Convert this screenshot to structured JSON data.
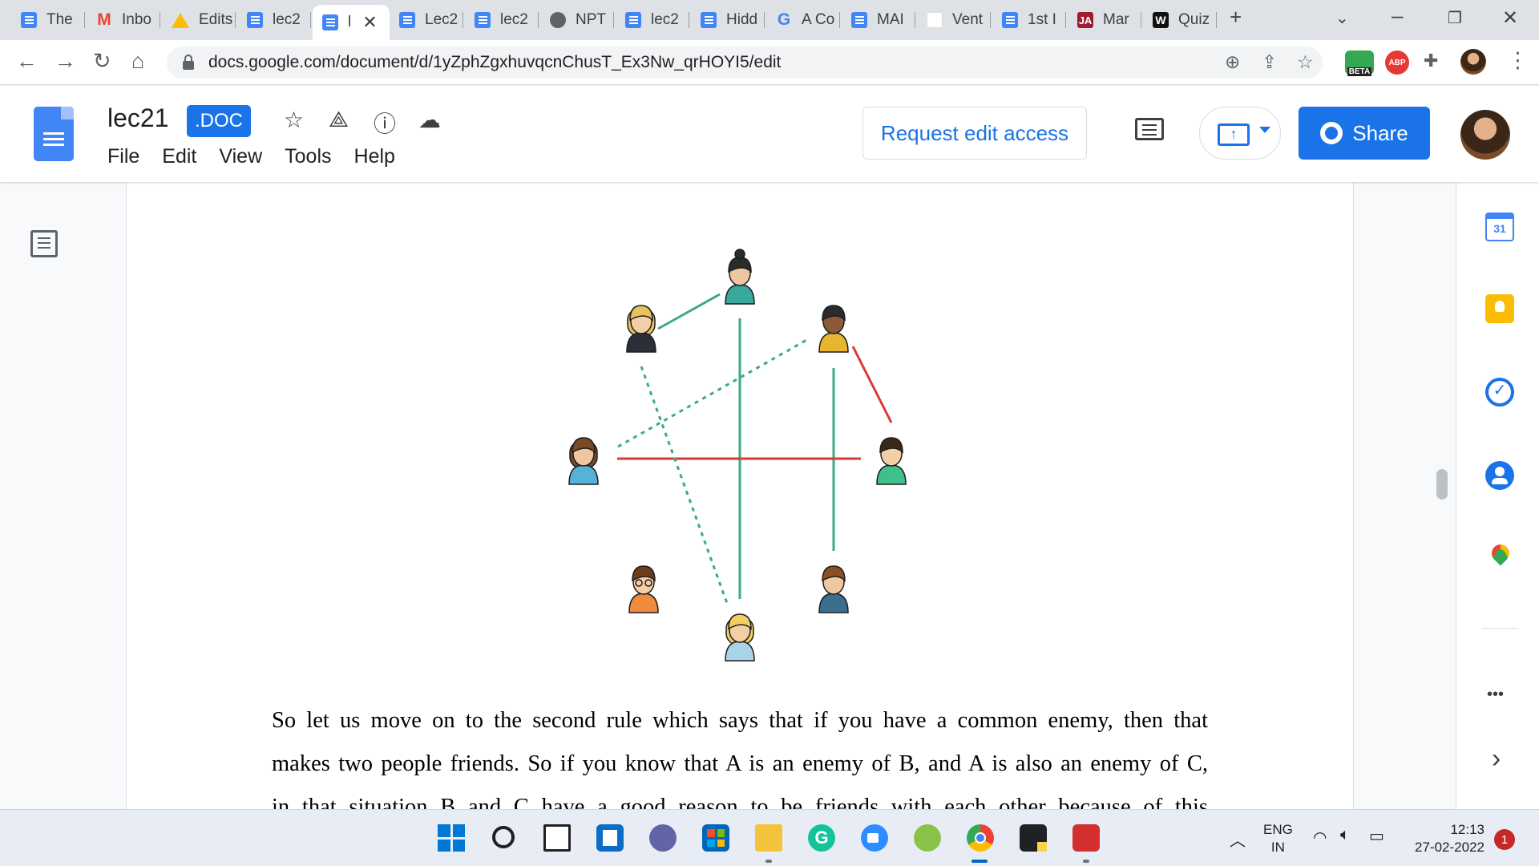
{
  "browser": {
    "tabs": [
      {
        "label": "The",
        "icon": "docs-icon",
        "kind": "doc"
      },
      {
        "label": "Inbo",
        "icon": "gmail-icon",
        "kind": "gm"
      },
      {
        "label": "Edits",
        "icon": "drive-icon",
        "kind": "dr"
      },
      {
        "label": "lec2",
        "icon": "docs-icon",
        "kind": "doc"
      },
      {
        "label": "l",
        "icon": "docs-icon",
        "kind": "doc",
        "active": true
      },
      {
        "label": "Lec2",
        "icon": "docs-icon",
        "kind": "doc"
      },
      {
        "label": "lec2",
        "icon": "docs-icon",
        "kind": "doc"
      },
      {
        "label": "NPT",
        "icon": "globe-icon",
        "kind": "globe"
      },
      {
        "label": "lec2",
        "icon": "docs-icon",
        "kind": "doc"
      },
      {
        "label": "Hidd",
        "icon": "docs-icon",
        "kind": "doc"
      },
      {
        "label": "A Co",
        "icon": "google-icon",
        "kind": "g"
      },
      {
        "label": "MAI",
        "icon": "docs-icon",
        "kind": "doc"
      },
      {
        "label": "Vent",
        "icon": "blank-page-icon",
        "kind": "blank"
      },
      {
        "label": "1st I",
        "icon": "docs-icon",
        "kind": "doc"
      },
      {
        "label": "Mar",
        "icon": "ja-icon",
        "kind": "ja"
      },
      {
        "label": "Quiz",
        "icon": "w-icon",
        "kind": "w"
      }
    ],
    "new_tab": "+",
    "close_tab": "✕",
    "url": "docs.google.com/document/d/1yZphZgxhuvqcnChusT_Ex3Nw_qrHOYI5/edit",
    "extensions": {
      "beta_label": "BETA",
      "abp_label": "ABP"
    }
  },
  "docs": {
    "title": "lec21",
    "badge": ".DOC",
    "menu": [
      "File",
      "Edit",
      "View",
      "Tools",
      "Help"
    ],
    "request_edit_label": "Request edit access",
    "share_label": "Share"
  },
  "figure": {
    "people": [
      {
        "id": "p1",
        "name": "woman-dark-hair-bun"
      },
      {
        "id": "p2",
        "name": "woman-blonde-dark-top"
      },
      {
        "id": "p3",
        "name": "man-dark-skin-yellow-shirt"
      },
      {
        "id": "p4",
        "name": "woman-brown-hair-blue-top"
      },
      {
        "id": "p5",
        "name": "man-green-shirt"
      },
      {
        "id": "p6",
        "name": "boy-glasses-orange-shirt"
      },
      {
        "id": "p7",
        "name": "man-blue-shirt"
      },
      {
        "id": "p8",
        "name": "woman-blonde-light-top"
      }
    ],
    "edges": [
      {
        "from": "p2",
        "to": "p1",
        "relation": "friend",
        "style": "solid",
        "color": "#3daa85"
      },
      {
        "from": "p1",
        "to": "p8",
        "relation": "friend",
        "style": "solid",
        "color": "#3daa85"
      },
      {
        "from": "p3",
        "to": "p7",
        "relation": "friend",
        "style": "solid",
        "color": "#3daa85"
      },
      {
        "from": "p3",
        "to": "p5",
        "relation": "enemy",
        "style": "solid",
        "color": "#d83a3a"
      },
      {
        "from": "p4",
        "to": "p5",
        "relation": "enemy",
        "style": "solid",
        "color": "#d83a3a"
      },
      {
        "from": "p4",
        "to": "p3",
        "relation": "inferred-friend",
        "style": "dashed",
        "color": "#3daa85"
      },
      {
        "from": "p2",
        "to": "p8",
        "relation": "inferred-friend",
        "style": "dashed",
        "color": "#3daa85"
      }
    ]
  },
  "content": {
    "paragraph_lines": [
      "So let us move on to the second rule which says that if you have a common enemy, then that",
      "makes two people friends. So if you know that A is an enemy of B, and A is also an enemy of C,",
      "in that situation B and C have a good reason to be friends with each other because of this"
    ]
  },
  "side_panel": [
    {
      "name": "calendar-icon",
      "label": "31"
    },
    {
      "name": "keep-icon"
    },
    {
      "name": "tasks-icon"
    },
    {
      "name": "contacts-icon"
    },
    {
      "name": "maps-icon"
    },
    {
      "name": "more-icon",
      "label": "•••"
    },
    {
      "name": "expand-panel-icon",
      "label": "›"
    }
  ],
  "taskbar": {
    "language": "ENG",
    "region": "IN",
    "time": "12:13",
    "date": "27-02-2022",
    "notifications": "1"
  },
  "colors": {
    "accent": "#1a73e8",
    "friend_edge": "#3daa85",
    "enemy_edge": "#d83a3a"
  }
}
